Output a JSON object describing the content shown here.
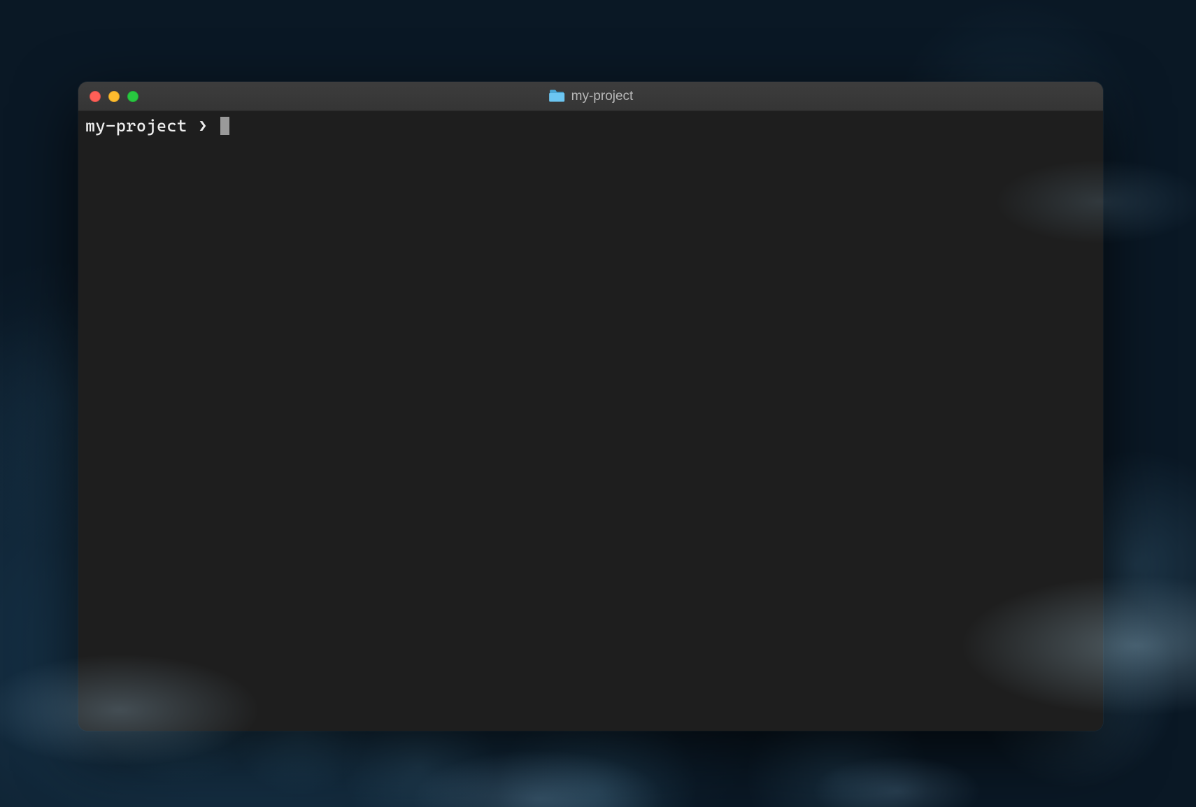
{
  "window": {
    "title": "my-project"
  },
  "terminal": {
    "prompt_dir": "my-project",
    "prompt_separator": "❯",
    "input_value": ""
  }
}
